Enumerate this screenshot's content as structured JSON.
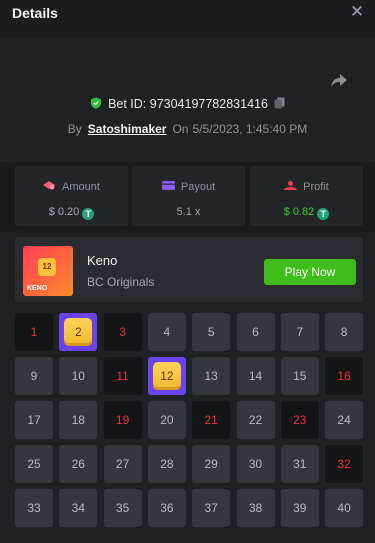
{
  "header": {
    "title": "Details"
  },
  "bet": {
    "id_text": "Bet ID: 97304197782831416",
    "by_label": "By",
    "user": "Satoshimaker",
    "on_label": "On",
    "datetime": "5/5/2023, 1:45:40 PM"
  },
  "stats": [
    {
      "label": "Amount",
      "value": "$ 0.20",
      "coin": "T"
    },
    {
      "label": "Payout",
      "value": "5.1 x"
    },
    {
      "label": "Profit",
      "value": "$ 0.82",
      "coin": "T"
    }
  ],
  "game": {
    "name": "Keno",
    "category": "BC Originals",
    "play_label": "Play Now",
    "thumb_number": "12",
    "thumb_text": "KENO"
  },
  "grid": {
    "numbers": [
      "1",
      "2",
      "3",
      "4",
      "5",
      "6",
      "7",
      "8",
      "9",
      "10",
      "11",
      "12",
      "13",
      "14",
      "15",
      "16",
      "17",
      "18",
      "19",
      "20",
      "21",
      "22",
      "23",
      "24",
      "25",
      "26",
      "27",
      "28",
      "29",
      "30",
      "31",
      "32",
      "33",
      "34",
      "35",
      "36",
      "37",
      "38",
      "39",
      "40"
    ],
    "hits": [
      2,
      12
    ],
    "misses": [
      1,
      3,
      11,
      16,
      19,
      21,
      23,
      32
    ]
  },
  "colors": {
    "accent_green": "#3ebd1b",
    "hit_purple": "#6a43ea",
    "miss_red": "#e4373c",
    "profit_green": "#3ccd2f"
  }
}
